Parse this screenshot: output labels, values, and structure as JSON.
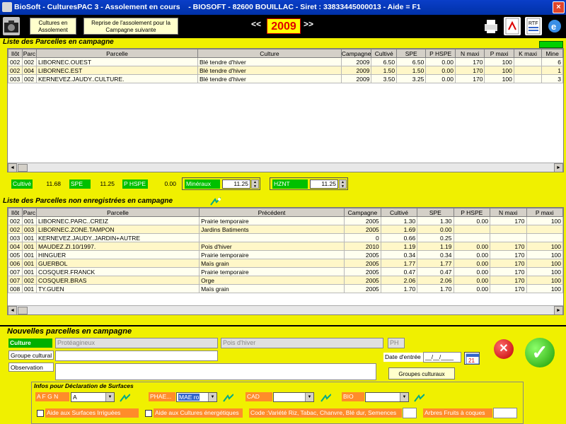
{
  "window": {
    "title": "BioSoft - CulturesPAC 3 - Assolement en cours    - BIOSOFT - 82600 BOUILLAC - Siret : 33833445000013 - Aide = F1",
    "close": "×"
  },
  "toolbar": {
    "btn_cultures": "Cultures en Assolement",
    "btn_reprise": "Reprise de l'assolement pour la Campagne suivante",
    "prev": "<<",
    "year": "2009",
    "next": ">>",
    "icons": [
      "camera-icon",
      "printer-icon",
      "pdf-icon",
      "rtf-icon",
      "internet-explorer-icon"
    ],
    "rtf_label": "RTF"
  },
  "campagne": {
    "title": "Liste des Parcelles en campagne",
    "columns": [
      "Ilôt",
      "Parc",
      "Parcelle",
      "Culture",
      "Campagne",
      "Cultivé",
      "SPE",
      "P HSPE",
      "N maxi",
      "P maxi",
      "K maxi",
      "Mine"
    ],
    "rows": [
      [
        "002",
        "002",
        "LIBORNEC.OUEST",
        "Blé tendre d'hiver",
        "2009",
        "6.50",
        "6.50",
        "0.00",
        "170",
        "100",
        "",
        "6"
      ],
      [
        "002",
        "004",
        "LIBORNEC.EST",
        "Blé tendre d'hiver",
        "2009",
        "1.50",
        "1.50",
        "0.00",
        "170",
        "100",
        "",
        "1"
      ],
      [
        "003",
        "002",
        "KERNEVEZ.JAUDY..CULTURE.",
        "Blé tendre d'hiver",
        "2009",
        "3.50",
        "3.25",
        "0.00",
        "170",
        "100",
        "",
        "3"
      ]
    ],
    "scroll_left": "◄",
    "scroll_right": "►"
  },
  "totals": {
    "cultive_label": "Cultivé",
    "cultive": "11.68",
    "spe_label": "SPE",
    "spe": "11.25",
    "phspe_label": "P HSPE",
    "phspe": "0.00",
    "mineraux_label": "Minéraux",
    "mineraux": "11.25",
    "hznt_label": "HZNT",
    "hznt": "11.25"
  },
  "non_enreg": {
    "title": "Liste des Parcelles non enregistrées en campagne",
    "columns": [
      "Ilôt",
      "Parc",
      "Parcelle",
      "Précédent",
      "Campagne",
      "Cultivé",
      "SPE",
      "P HSPE",
      "N maxi",
      "P maxi"
    ],
    "rows": [
      [
        "002",
        "001",
        "LIBORNEC.PARC..CREIZ",
        "Prairie temporaire",
        "2005",
        "1.30",
        "1.30",
        "0.00",
        "170",
        "100"
      ],
      [
        "002",
        "003",
        "LIBORNEC.ZONE.TAMPON",
        "Jardins Batiments",
        "2005",
        "1.69",
        "0.00",
        "",
        "",
        ""
      ],
      [
        "003",
        "001",
        "KERNEVEZ.JAUDY..JARDIN+AUTRE",
        "",
        "0",
        "0.66",
        "0.25",
        "",
        "",
        ""
      ],
      [
        "004",
        "001",
        "MAUDEZ.ZI.10/1997.",
        "Pois d'hiver",
        "2010",
        "1.19",
        "1.19",
        "0.00",
        "170",
        "100"
      ],
      [
        "005",
        "001",
        "HINGUER",
        "Prairie temporaire",
        "2005",
        "0.34",
        "0.34",
        "0.00",
        "170",
        "100"
      ],
      [
        "006",
        "001",
        "GUERBOL",
        "Maïs grain",
        "2005",
        "1.77",
        "1.77",
        "0.00",
        "170",
        "100"
      ],
      [
        "007",
        "001",
        "COSQUER.FRANCK",
        "Prairie temporaire",
        "2005",
        "0.47",
        "0.47",
        "0.00",
        "170",
        "100"
      ],
      [
        "007",
        "002",
        "COSQUER.BRAS",
        "Orge",
        "2005",
        "2.06",
        "2.06",
        "0.00",
        "170",
        "100"
      ],
      [
        "008",
        "001",
        "TY.GUEN",
        "Maïs grain",
        "2005",
        "1.70",
        "1.70",
        "0.00",
        "170",
        "100"
      ]
    ],
    "scroll_left": "◄",
    "scroll_right": "►"
  },
  "nouvelles": {
    "title": "Nouvelles parcelles en campagne",
    "culture_label": "Culture",
    "culture_value": "Protéagineux",
    "culture_detail": "Pois d'hiver",
    "ph_label": "PH",
    "groupe_label": "Groupe cultural",
    "groupe_value": "",
    "date_label": "Date d'entrée",
    "date_value": "__/__/____",
    "observation_label": "Observation",
    "observation_value": "",
    "btn_groupes": "Groupes culturaux",
    "cancel": "✕",
    "ok": "✓"
  },
  "infos": {
    "title": "Infos pour Déclaration de Surfaces",
    "afgn_label": "A F G N",
    "afgn_value": "A",
    "phae_label": "PHAE...",
    "phae_value": "MAE ro",
    "cad_label": "CAD",
    "cad_value": "",
    "bio_label": "BIO",
    "bio_value": "",
    "irrigues": "Aide aux Surfaces Irriguées",
    "energetiques": "Aide aux Cultures énergétiques",
    "code_variete": "Code :Variété Riz, Tabac, Chanvre, Blé dur, Semences",
    "arbres": "Arbres Fruits à coques"
  }
}
